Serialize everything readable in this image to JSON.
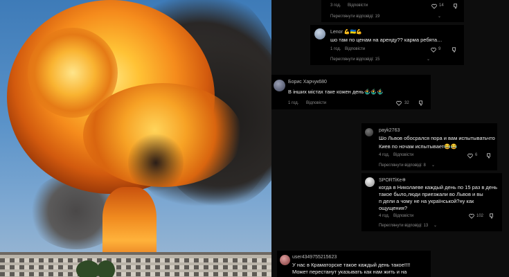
{
  "comments": [
    {
      "username": "",
      "lines": [],
      "meta": "3 год.",
      "reply": "Відповісти",
      "likes": "14",
      "view_replies": "Переглянути відповіді: 19"
    },
    {
      "username": "Lenor 💪🇺🇦💪",
      "lines": [
        "шо там по ценам на аренду?? карма ребята…"
      ],
      "meta": "1 год.",
      "reply": "Відповісти",
      "likes": "9",
      "view_replies": "Переглянути відповіді: 15"
    },
    {
      "username": "Борис Харчук680",
      "lines": [
        "В інших містах таке кожен день🤹‍♂️🤹‍♂️🤹‍♂️"
      ],
      "meta": "1 год.",
      "reply": "Відповісти",
      "likes": "32",
      "view_replies": ""
    },
    {
      "username": "payk2763",
      "lines": [
        "Шо Львов обосрался пора и вам испытыватьчто",
        "Киев по ночам испытывает😂😂"
      ],
      "meta": "4 год.",
      "reply": "Відповісти",
      "likes": "6",
      "view_replies": "Переглянути відповіді: 8"
    },
    {
      "username": "SPORTiКе❄",
      "lines": [
        "когда в Николаеве каждый день по 15 раз в день",
        "такое было,люди приезжали во Львов и вы",
        "п    дели а чому не на українськой?ну как",
        "ощущения?"
      ],
      "meta": "4 год.",
      "reply": "Відповісти",
      "likes": "102",
      "view_replies": "Переглянути відповіді: 13"
    },
    {
      "username": "user4349755215623",
      "lines": [
        "У нас в Краматорске такое каждый день такое!!!!",
        "Может перестанут указывать как нам жить и на"
      ],
      "meta": "",
      "reply": "",
      "likes": "",
      "view_replies": ""
    }
  ],
  "icons": {
    "like": "heart-outline-icon",
    "dislike": "thumbs-down-icon",
    "chevron": "chevron-down-icon"
  },
  "colors": {
    "panel_bg": "#0d0d0d",
    "card_bg": "#000000",
    "text": "#f0f0f0",
    "muted": "#8a8a8a"
  }
}
